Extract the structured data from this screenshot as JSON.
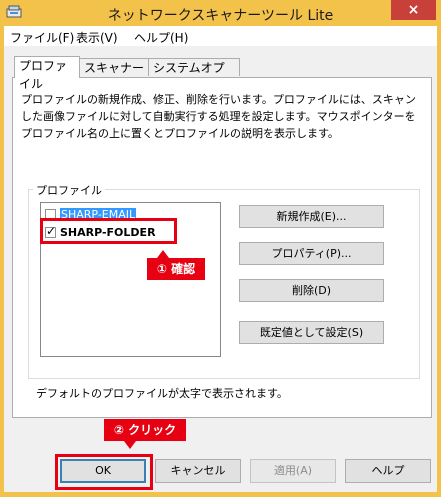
{
  "window": {
    "title": "ネットワークスキャナーツール Lite",
    "close_glyph": "×"
  },
  "menu": [
    "ファイル(F)",
    "表示(V)",
    "ヘルプ(H)"
  ],
  "tabs": [
    "プロファイル",
    "スキャナー",
    "システムオプション"
  ],
  "description": "プロファイルの新規作成、修正、削除を行います。プロファイルには、スキャンした画像ファイルに対して自動実行する処理を設定します。マウスポインターをプロファイル名の上に置くとプロファイルの説明を表示します。",
  "profile_group": {
    "label": "プロファイル",
    "items": [
      {
        "name": "SHARP-EMAIL",
        "checked": false,
        "selected": true,
        "bold": false
      },
      {
        "name": "SHARP-FOLDER",
        "checked": true,
        "selected": false,
        "bold": true
      }
    ],
    "check_glyph": "✓",
    "buttons": {
      "new": "新規作成(E)...",
      "properties": "プロパティ(P)...",
      "delete": "削除(D)",
      "set_default": "既定値として設定(S)"
    },
    "note": "デフォルトのプロファイルが太字で表示されます。"
  },
  "dialog_buttons": {
    "ok": "OK",
    "cancel": "キャンセル",
    "apply": "適用(A)",
    "help": "ヘルプ"
  },
  "annotations": {
    "confirm": "① 確認",
    "click": "② クリック"
  },
  "colors": {
    "window_frame": "#f3c24b",
    "close_button": "#c7403a",
    "selection": "#3399ff",
    "annotation_red": "#e60012"
  }
}
